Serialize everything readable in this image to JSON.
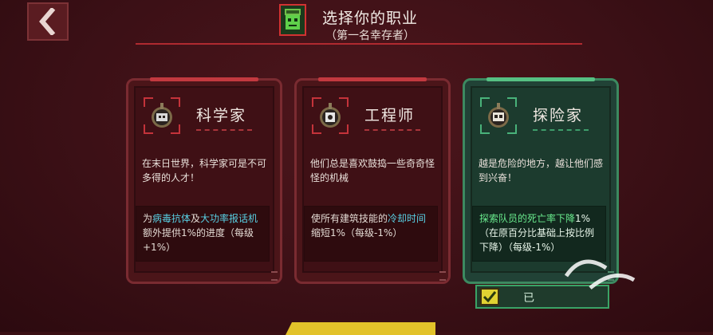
{
  "header": {
    "title": "选择你的职业",
    "subtitle": "（第一名幸存者）"
  },
  "colors": {
    "background": "#3c1016",
    "card_border": "#7a2b31",
    "selected_border": "#3c8a60",
    "accent_red": "#c2393f",
    "highlight_cyan": "#58cfe3",
    "highlight_green": "#69ea8d"
  },
  "cards": [
    {
      "name": "科学家",
      "icon": "scientist-emblem-icon",
      "description": "在末日世界，科学家可是不可多得的人才！",
      "bonus": {
        "p1": "为",
        "h1": "病毒抗体",
        "p2": "及",
        "h2": "大功率报话机",
        "p3": "额外提供1%的进度（每级+1%）"
      },
      "selected": false
    },
    {
      "name": "工程师",
      "icon": "engineer-emblem-icon",
      "description": "他们总是喜欢鼓捣一些奇奇怪怪的机械",
      "bonus": {
        "p1": "使所有建筑技能的",
        "h1": "冷却时间",
        "p2": "缩短1%（每级-1%）"
      },
      "selected": false
    },
    {
      "name": "探险家",
      "icon": "explorer-emblem-icon",
      "description": "越是危险的地方，越让他们感到兴奋！",
      "bonus": {
        "h1": "探索队员的死亡率下降",
        "p1": "1%（在原百分比基础上按比例下降）（每级-1%）"
      },
      "selected": true
    }
  ],
  "select_button": {
    "label": "已"
  }
}
